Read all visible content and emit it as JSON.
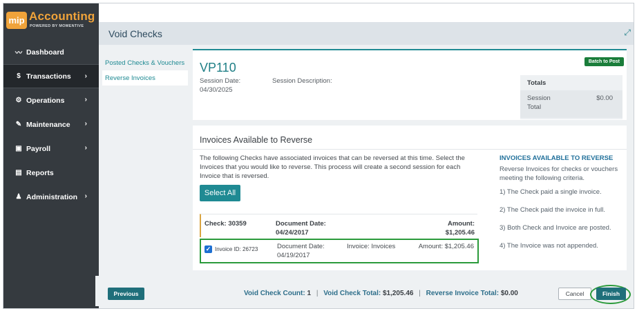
{
  "brand": {
    "badge": "mip",
    "title": "Accounting",
    "subtitle": "POWERED BY MOMENTIVE"
  },
  "sidebar": {
    "items": [
      {
        "label": "Dashboard",
        "icon": "chart-line-icon",
        "glyph": "📈",
        "chevron": false
      },
      {
        "label": "Transactions",
        "icon": "dollar-icon",
        "glyph": "$",
        "chevron": true,
        "active": true
      },
      {
        "label": "Operations",
        "icon": "cogs-icon",
        "glyph": "⚙",
        "chevron": true
      },
      {
        "label": "Maintenance",
        "icon": "wrench-icon",
        "glyph": "🔧",
        "chevron": true
      },
      {
        "label": "Payroll",
        "icon": "money-icon",
        "glyph": "💵",
        "chevron": true
      },
      {
        "label": "Reports",
        "icon": "file-icon",
        "glyph": "📄",
        "chevron": false
      },
      {
        "label": "Administration",
        "icon": "users-icon",
        "glyph": "👥",
        "chevron": true
      }
    ]
  },
  "page": {
    "title": "Void Checks"
  },
  "subnav": {
    "items": [
      "Posted Checks & Vouchers",
      "Reverse Invoices"
    ]
  },
  "session": {
    "id": "VP110",
    "date_label": "Session Date:",
    "date_value": "04/30/2025",
    "description_label": "Session Description:",
    "batch_button": "Batch to Post",
    "totals_header": "Totals",
    "totals_label_1": "Session",
    "totals_label_2": "Total",
    "totals_value": "$0.00"
  },
  "invoices": {
    "title": "Invoices Available to Reverse",
    "description": "The following Checks have associated invoices that can be reversed at this time. Select the Invoices that you would like to reverse. This process will create a second session for each Invoice that is reversed.",
    "select_all": "Select All",
    "check": {
      "label": "Check: 30359",
      "doc_date_label": "Document Date:",
      "doc_date_value": "04/24/2017",
      "amount_label": "Amount:",
      "amount_value": "$1,205.46"
    },
    "invoice": {
      "id_label": "Invoice ID: 26723",
      "doc_date_label": "Document Date:",
      "doc_date_value": "04/19/2017",
      "type": "Invoice: Invoices",
      "amount": "Amount: $1,205.46",
      "checked": true
    },
    "criteria": {
      "title": "INVOICES AVAILABLE TO REVERSE",
      "intro": "Reverse Invoices for checks or vouchers meeting the following criteria.",
      "items": [
        "1) The Check paid a single invoice.",
        "2) The Check paid the invoice in full.",
        "3) Both Check and Invoice are posted.",
        "4) The Invoice was not appended."
      ]
    }
  },
  "footer": {
    "previous": "Previous",
    "void_count_label": "Void Check Count:",
    "void_count_value": "1",
    "void_total_label": "Void Check Total:",
    "void_total_value": "$1,205.46",
    "reverse_total_label": "Reverse Invoice Total:",
    "reverse_total_value": "$0.00",
    "separator": "|",
    "cancel": "Cancel",
    "finish": "Finish"
  },
  "colors": {
    "accent": "#1f8a93",
    "brand": "#f0a33a",
    "highlight": "#2a9a3a",
    "sidebar": "#353a3f"
  }
}
